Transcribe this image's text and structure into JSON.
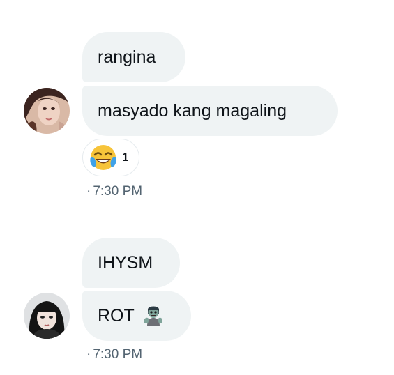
{
  "conversation": {
    "groups": [
      {
        "messages": [
          {
            "text": "rangina"
          },
          {
            "text": "masyado kang magaling"
          }
        ],
        "reaction": {
          "emoji": "face-with-tears-of-joy",
          "count": "1"
        },
        "timestamp": "7:30 PM",
        "separator": "·"
      },
      {
        "messages": [
          {
            "text": "IHYSM"
          },
          {
            "text": "ROT",
            "emoji": "zombie"
          }
        ],
        "timestamp": "7:30 PM",
        "separator": "·"
      }
    ]
  },
  "colors": {
    "bubble_bg": "#eff3f4",
    "text": "#0f1419",
    "timestamp": "#536471",
    "reaction_border": "#e6ebee"
  }
}
